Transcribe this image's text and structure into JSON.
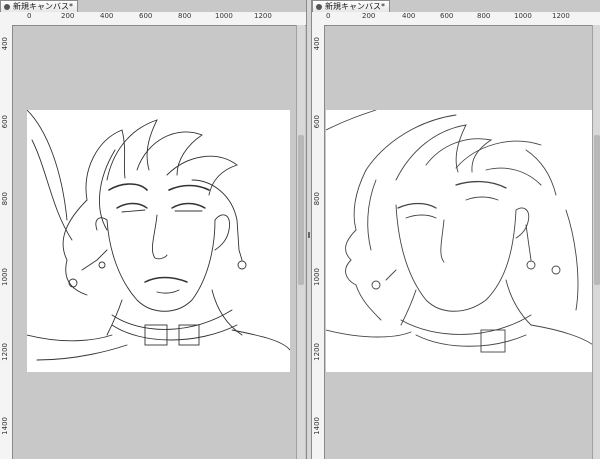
{
  "tabs": {
    "left": "新規キャンバス*",
    "right": "新規キャンバス*"
  },
  "rulers": {
    "horizontal": [
      "0",
      "200",
      "400",
      "600",
      "800",
      "1000",
      "1200"
    ],
    "vertical": [
      "400",
      "600",
      "800",
      "1000",
      "1200",
      "1400"
    ]
  },
  "icons": {
    "tab_close": "close-icon",
    "splitter_grip": "grip-icon"
  }
}
